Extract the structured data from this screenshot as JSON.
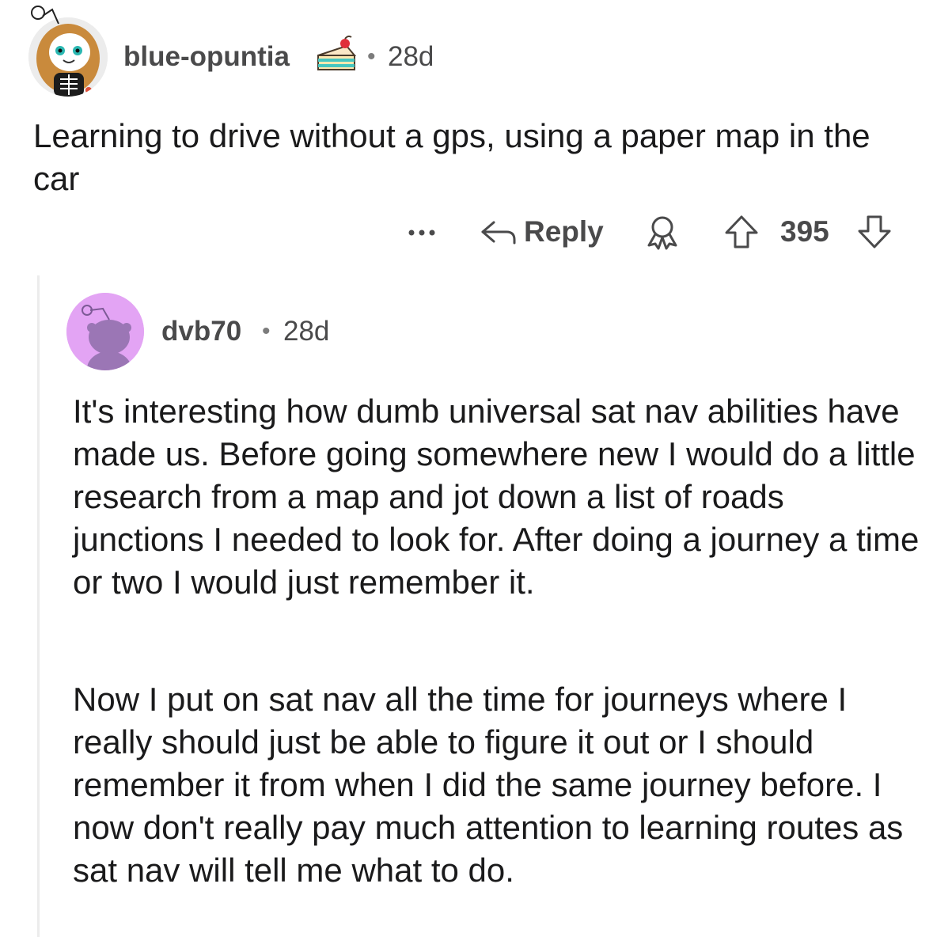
{
  "parent_comment": {
    "username": "blue-opuntia",
    "separator": "•",
    "age": "28d",
    "flair_icon": "cake-icon",
    "body": "Learning to drive without a gps, using a paper map in the car",
    "actions": {
      "more_icon": "more-options-icon",
      "reply_label": "Reply",
      "award_icon": "award-icon",
      "vote_count": "395"
    }
  },
  "reply_comment": {
    "username": "dvb70",
    "separator": "•",
    "age": "28d",
    "paragraphs": [
      "It's interesting how dumb universal sat nav abilities have made us.  Before going somewhere new I would do a little research from a map and jot down a list of roads junctions I needed to look for. After doing a journey a time or two I would just remember it.",
      "Now I put on sat nav all the time for journeys where I really should just be able to figure it out or I should remember it from when I did the same journey before.  I now don't really pay much attention to learning routes as sat nav will tell me what to do."
    ]
  },
  "colors": {
    "text": "#1a1a1b",
    "meta": "#4a4a4b",
    "avatar_reply_bg": "#e3a4f4",
    "snoo_purple": "#9b76b5"
  }
}
